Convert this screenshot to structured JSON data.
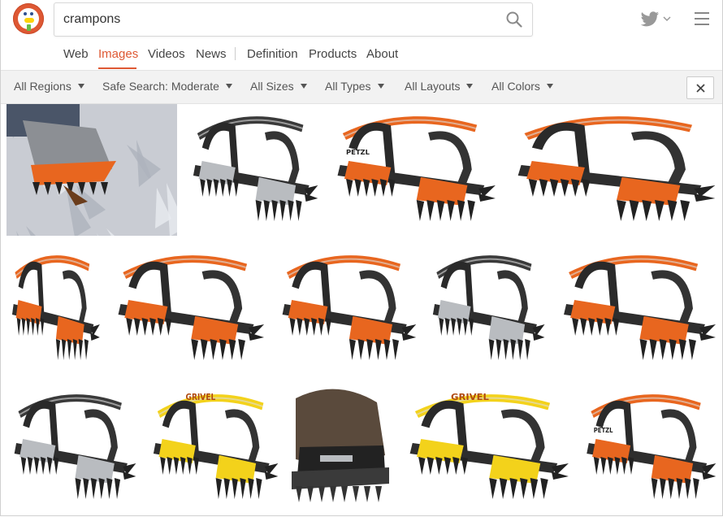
{
  "search": {
    "query": "crampons",
    "placeholder": ""
  },
  "nav": {
    "items": [
      {
        "label": "Web",
        "active": false
      },
      {
        "label": "Images",
        "active": true
      },
      {
        "label": "Videos",
        "active": false
      },
      {
        "label": "News",
        "active": false
      },
      {
        "label": "Definition",
        "active": false
      },
      {
        "label": "Products",
        "active": false
      },
      {
        "label": "About",
        "active": false
      }
    ]
  },
  "filters": {
    "region": "All Regions",
    "safe_search": "Safe Search: Moderate",
    "size": "All Sizes",
    "type": "All Types",
    "layout": "All Layouts",
    "color": "All Colors"
  },
  "icons": {
    "logo": "duckduckgo-logo",
    "search": "search-icon",
    "twitter": "twitter-icon",
    "menu": "hamburger-menu-icon",
    "close": "close-icon"
  },
  "colors": {
    "brand": "#de5833",
    "crampon_orange": "#e8661f",
    "crampon_yellow": "#f3d21b",
    "metal": "#b9bcc0",
    "dark": "#2a2a2a"
  },
  "images": [
    {
      "style": "photo-ice"
    },
    {
      "style": "black-silver"
    },
    {
      "style": "orange"
    },
    {
      "style": "orange-flat"
    },
    {
      "style": "orange-small"
    },
    {
      "style": "orange"
    },
    {
      "style": "orange"
    },
    {
      "style": "black-silver"
    },
    {
      "style": "orange"
    },
    {
      "style": "black-silver"
    },
    {
      "style": "yellow"
    },
    {
      "style": "boot"
    },
    {
      "style": "yellow"
    },
    {
      "style": "orange"
    }
  ],
  "grivel_text": "GRIVEL",
  "petzl_text": "PETZL"
}
